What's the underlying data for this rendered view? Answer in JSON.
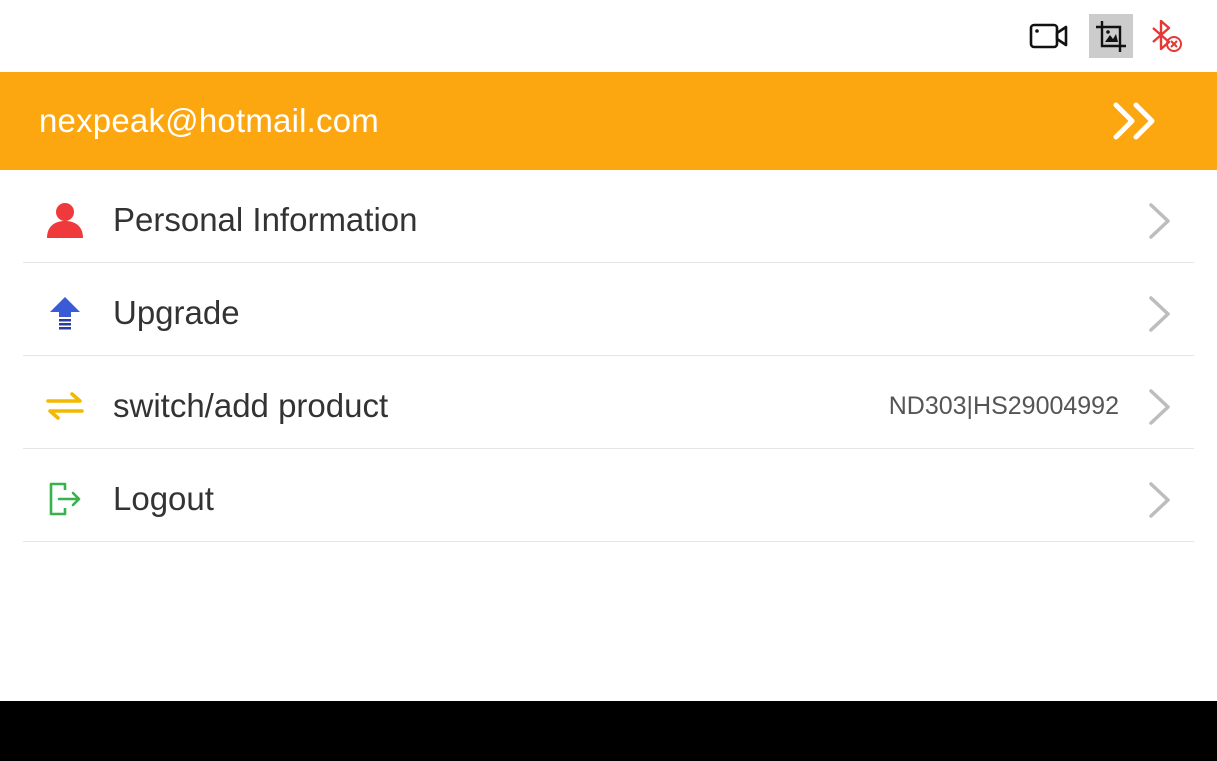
{
  "status_bar": {
    "icons": [
      "video-camera-icon",
      "crop-image-icon",
      "bluetooth-disabled-icon"
    ]
  },
  "account": {
    "email": "nexpeak@hotmail.com",
    "arrow_icon": "double-chevron-right-icon"
  },
  "menu": {
    "items": [
      {
        "label": "Personal Information",
        "value": "",
        "icon": "person-icon"
      },
      {
        "label": "Upgrade",
        "value": "",
        "icon": "upgrade-arrow-icon"
      },
      {
        "label": "switch/add product",
        "value": "ND303|HS29004992",
        "icon": "switch-arrows-icon"
      },
      {
        "label": "Logout",
        "value": "",
        "icon": "logout-icon"
      }
    ]
  },
  "colors": {
    "accent": "#fca610",
    "person_icon": "#f0393a",
    "upgrade_icon": "#3b5bd6",
    "switch_icon": "#f5b800",
    "logout_icon": "#37b34a",
    "bluetooth_off": "#e53935"
  }
}
